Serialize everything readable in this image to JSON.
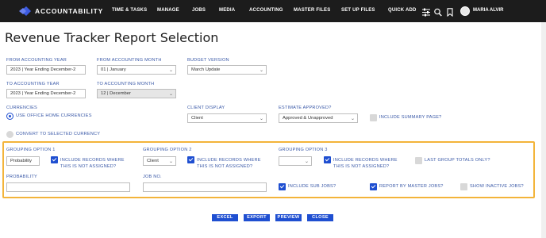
{
  "app": {
    "brand": "ACCOUNTABILITY",
    "user_name": "MARIA ALVIR"
  },
  "nav": {
    "items": [
      "TIME & TASKS",
      "MANAGE",
      "JOBS",
      "MEDIA",
      "ACCOUNTING",
      "MASTER FILES",
      "SET UP FILES",
      "QUICK ADD"
    ]
  },
  "page": {
    "title": "Revenue Tracker Report Selection"
  },
  "form": {
    "from_year": {
      "label": "FROM ACCOUNTING YEAR",
      "value": "2023 | Year Ending December-2"
    },
    "from_month": {
      "label": "FROM ACCOUNTING MONTH",
      "value": "01 | January"
    },
    "budget_version": {
      "label": "BUDGET VERSION",
      "value": "March Update"
    },
    "to_year": {
      "label": "TO ACCOUNTING YEAR",
      "value": "2023 | Year Ending December-2"
    },
    "to_month": {
      "label": "TO ACCOUNTING MONTH",
      "value": "12 | December"
    },
    "currencies": {
      "label": "CURRENCIES",
      "option_home": "USE OFFICE HOME CURRENCIES",
      "option_selected": "CONVERT TO SELECTED CURRENCY"
    },
    "client_display": {
      "label": "CLIENT DISPLAY",
      "value": "Client"
    },
    "estimate_approved": {
      "label": "ESTIMATE APPROVED?",
      "value": "Approved & Unapproved"
    },
    "include_summary": {
      "label": "INCLUDE SUMMARY PAGE?",
      "checked": false
    }
  },
  "grouping": {
    "option1": {
      "label": "GROUPING OPTION 1",
      "value": "Probability",
      "include_label_1": "INCLUDE RECORDS WHERE",
      "include_label_2": "THIS IS NOT ASSIGNED?",
      "checked": true
    },
    "option2": {
      "label": "GROUPING OPTION 2",
      "value": "Client",
      "include_label_1": "INCLUDE RECORDS WHERE",
      "include_label_2": "THIS IS NOT ASSIGNED?",
      "checked": true
    },
    "option3": {
      "label": "GROUPING OPTION 3",
      "value": "",
      "include_label_1": "INCLUDE RECORDS WHERE",
      "include_label_2": "THIS IS NOT ASSIGNED?",
      "checked": true
    },
    "last_group_totals": {
      "label": "LAST GROUP TOTALS ONLY?",
      "checked": false
    },
    "probability": {
      "label": "PROBABILITY",
      "value": ""
    },
    "job_no": {
      "label": "JOB NO.",
      "value": ""
    },
    "include_sub_jobs": {
      "label": "INCLUDE SUB JOBS?",
      "checked": true
    },
    "report_by_master": {
      "label": "REPORT BY MASTER JOBS?",
      "checked": true
    },
    "show_inactive": {
      "label": "SHOW INACTIVE JOBS?",
      "checked": false
    }
  },
  "actions": {
    "excel": "EXCEL",
    "export": "EXPORT",
    "preview": "PREVIEW",
    "close": "CLOSE"
  },
  "colors": {
    "topbar": "#1c1c1c",
    "label_blue": "#3b5aa8",
    "accent_blue": "#1f4fd1",
    "highlight_border": "#f3b43a"
  }
}
